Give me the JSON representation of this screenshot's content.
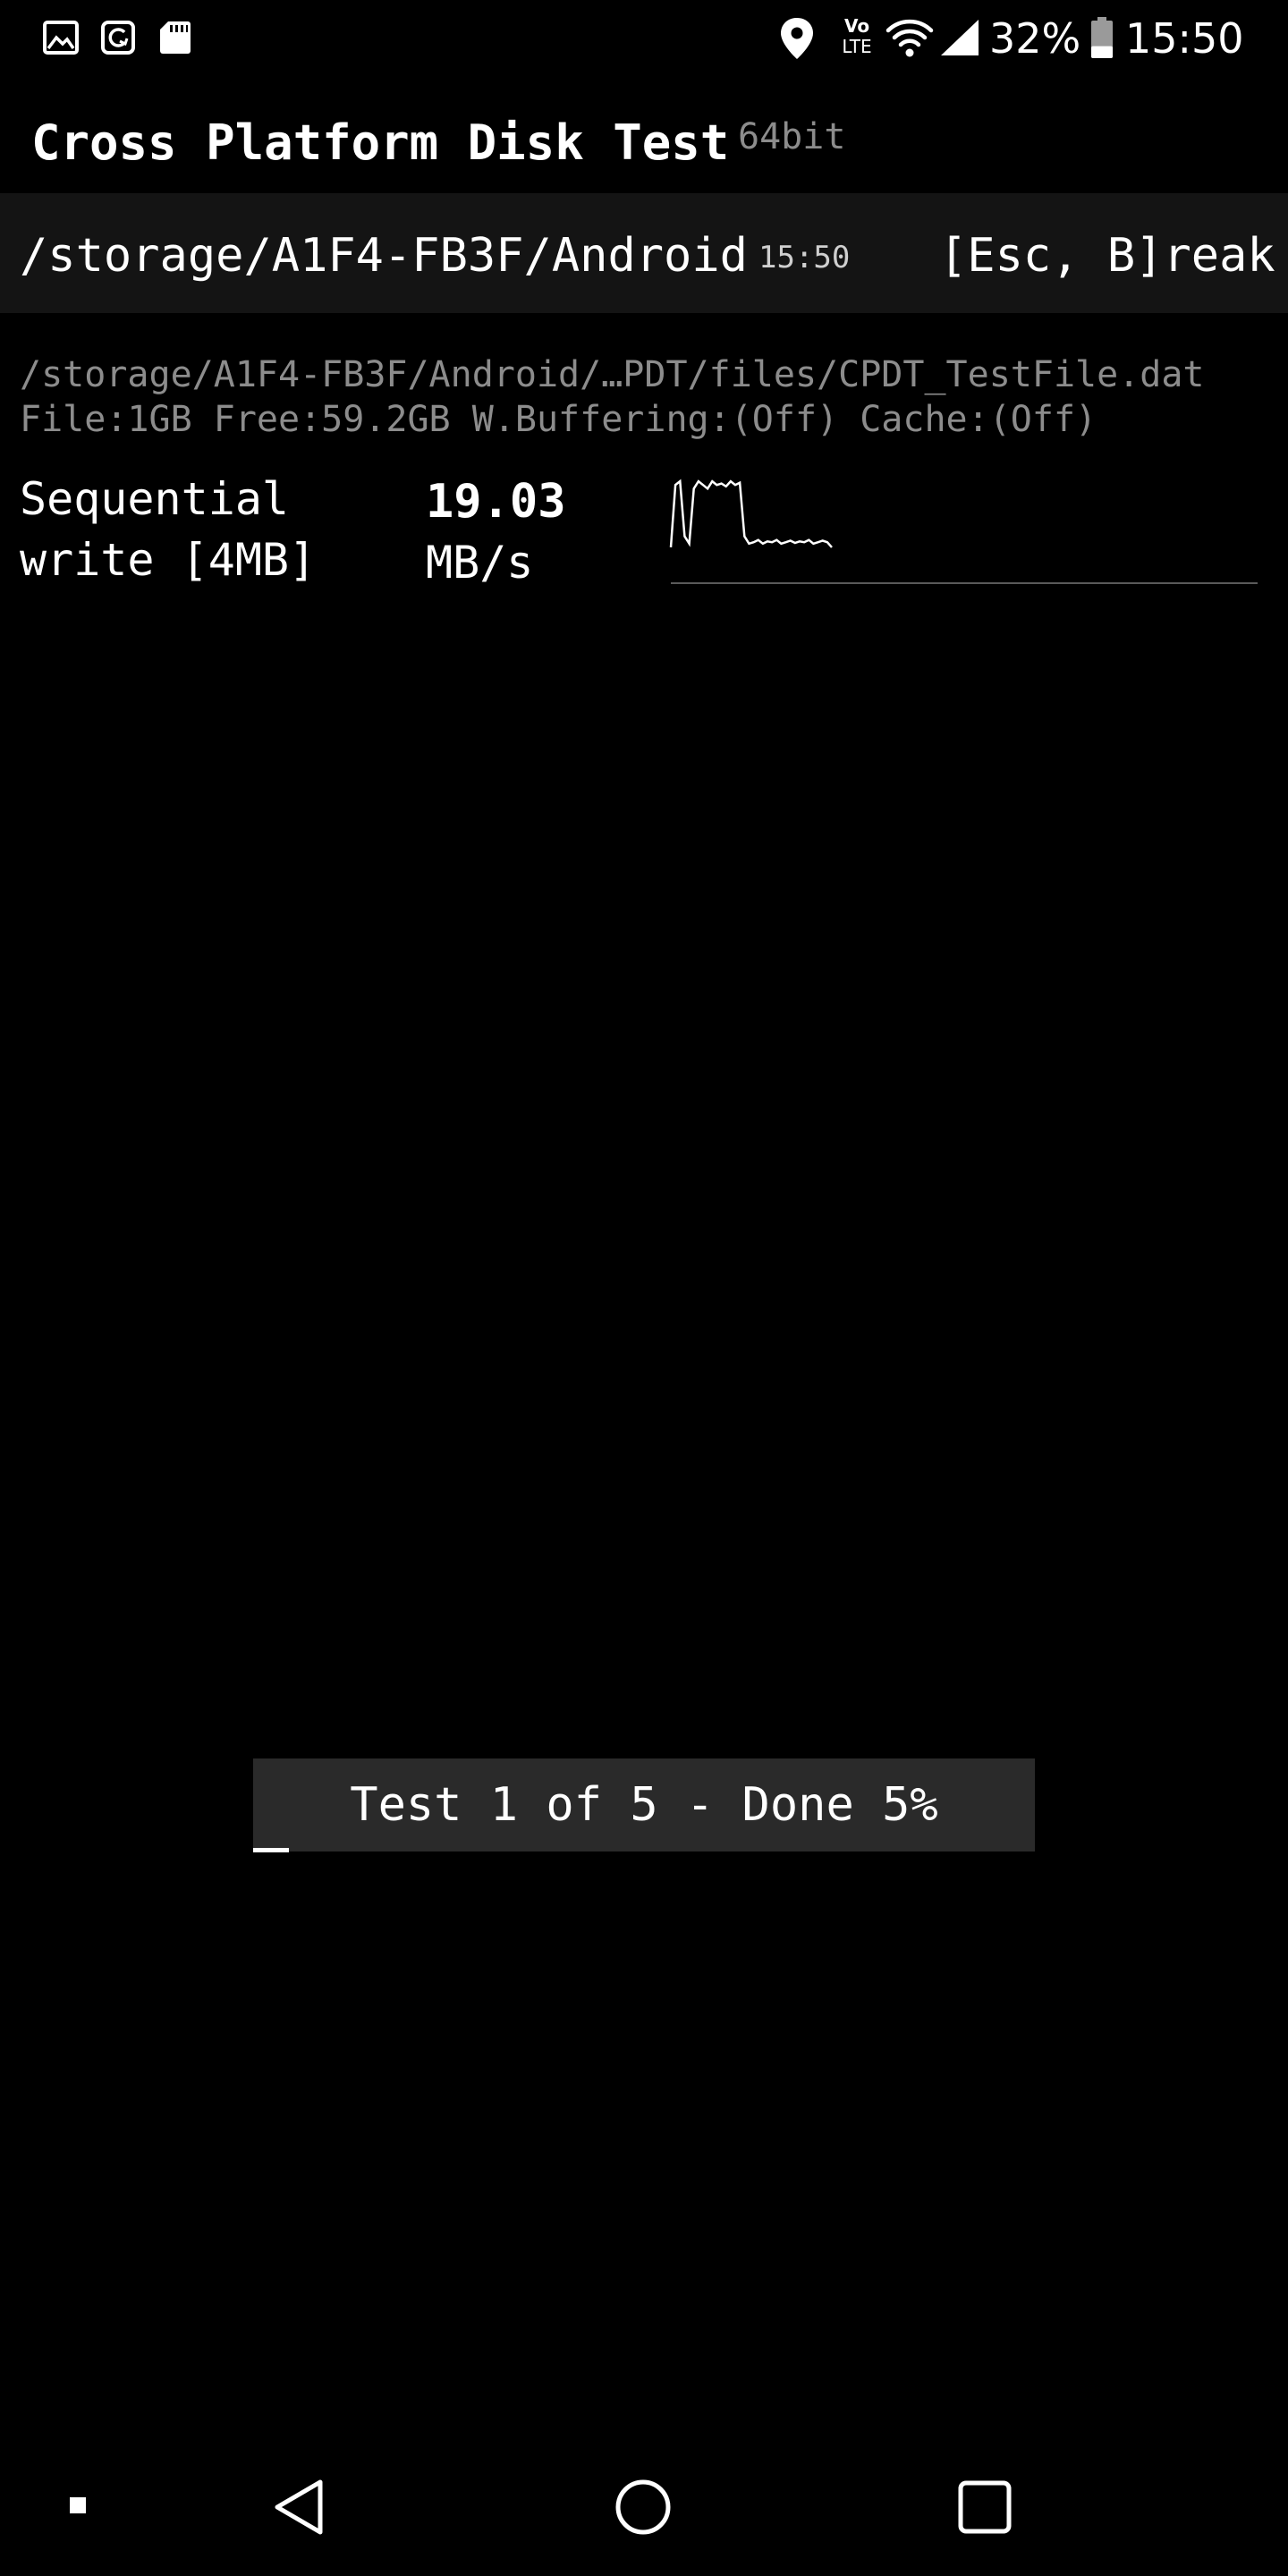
{
  "status_bar": {
    "left_icons": [
      "gallery-icon",
      "sync-icon",
      "sd-card-icon"
    ],
    "right_icons": [
      "location-icon",
      "volte-icon",
      "wifi-icon",
      "signal-icon",
      "battery-icon"
    ],
    "volte_label": "Vo\nLTE",
    "battery_percent": "32%",
    "battery_level": 0.32,
    "time": "15:50"
  },
  "app": {
    "title": "Cross Platform Disk Test",
    "arch": "64bit"
  },
  "path_bar": {
    "path": "/storage/A1F4-FB3F/Android",
    "time": "15:50",
    "break_label": "[Esc, B]reak"
  },
  "file": {
    "path": "/storage/A1F4-FB3F/Android/…PDT/files/CPDT_TestFile.dat",
    "info": "File:1GB Free:59.2GB W.Buffering:(Off) Cache:(Off)"
  },
  "test": {
    "name_line1": "Sequential",
    "name_line2": "write [4MB]",
    "speed_value": "19.03",
    "speed_unit": "MB/s",
    "sparkline": [
      0.05,
      0.9,
      0.95,
      0.2,
      0.1,
      0.85,
      0.95,
      0.9,
      0.85,
      0.95,
      0.9,
      0.92,
      0.88,
      0.95,
      0.9,
      0.93,
      0.2,
      0.1,
      0.12,
      0.15,
      0.1,
      0.13,
      0.12,
      0.15,
      0.1,
      0.12,
      0.14,
      0.11,
      0.13,
      0.12,
      0.15,
      0.1,
      0.12,
      0.14,
      0.12,
      0.05
    ]
  },
  "progress": {
    "text": "Test 1 of 5 - Done 5%",
    "percent": 5
  },
  "nav_bar": {
    "icons": [
      "small-square-icon",
      "back-icon",
      "home-icon",
      "recents-icon"
    ]
  }
}
